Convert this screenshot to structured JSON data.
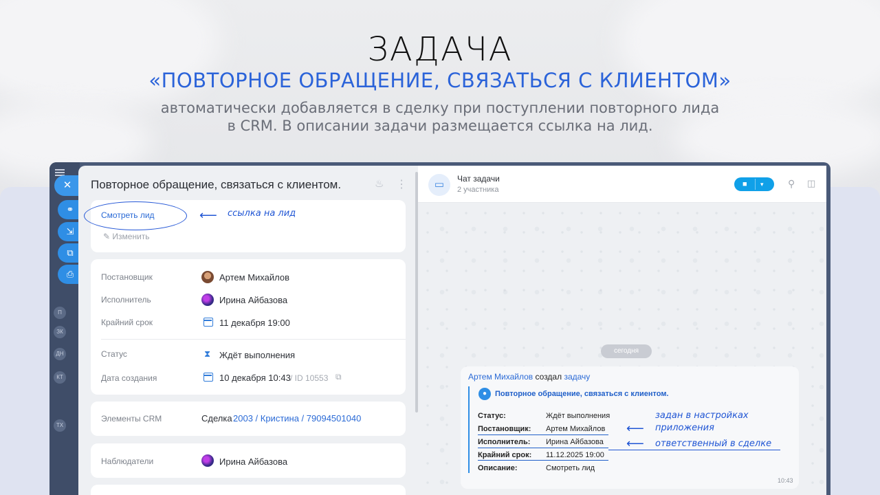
{
  "hero": {
    "title": "ЗАДАЧА",
    "subtitle": "«ПОВТОРНОЕ ОБРАЩЕНИЕ, СВЯЗАТЬСЯ С КЛИЕНТОМ»",
    "desc_line1": "автоматически добавляется в сделку при поступлении повторного лида",
    "desc_line2": "в CRM. В описании задачи размещается ссылка на лид."
  },
  "rail": {
    "letters": [
      "П",
      "ЗК",
      "ДН",
      "КТ",
      "ТХ"
    ]
  },
  "task": {
    "title": "Повторное обращение, связаться с клиентом.",
    "view_lead": "Смотреть лид",
    "edit": "Изменить",
    "fields": {
      "creator_label": "Постановщик",
      "creator": "Артем Михайлов",
      "assignee_label": "Исполнитель",
      "assignee": "Ирина Айбазова",
      "deadline_label": "Крайний срок",
      "deadline": "11 декабря 19:00",
      "status_label": "Статус",
      "status": "Ждёт выполнения",
      "created_label": "Дата создания",
      "created": "10 декабря 10:43",
      "id": "/ ID 10553",
      "crm_label": "Элементы CRM",
      "crm_prefix": "Сделка",
      "crm_link": "2003 / Кристина / 79094501040",
      "observers_label": "Наблюдатели",
      "observer": "Ирина Айбазова"
    }
  },
  "chat": {
    "title": "Чат задачи",
    "subtitle": "2 участника",
    "today": "сегодня",
    "author": "Артем Михайлов",
    "action": "создал",
    "action_link": "задачу",
    "card_title": "Повторное обращение, связаться с клиентом.",
    "rows": [
      {
        "k": "Статус:",
        "v": "Ждёт выполнения"
      },
      {
        "k": "Постановщик:",
        "v": "Артем Михайлов"
      },
      {
        "k": "Исполнитель:",
        "v": "Ирина Айбазова"
      },
      {
        "k": "Крайний срок:",
        "v": "11.12.2025 19:00"
      },
      {
        "k": "Описание:",
        "v": "Смотреть лид"
      }
    ],
    "time": "10:43"
  },
  "annotations": {
    "lead_link": "ссылка на лид",
    "settings_1": "задан в настройках",
    "settings_2": "приложения",
    "responsible": "ответственный в сделке"
  },
  "colors": {
    "accent": "#2b63d9",
    "chat_blue": "#2f8ee5",
    "annotation": "#1f55d4"
  }
}
